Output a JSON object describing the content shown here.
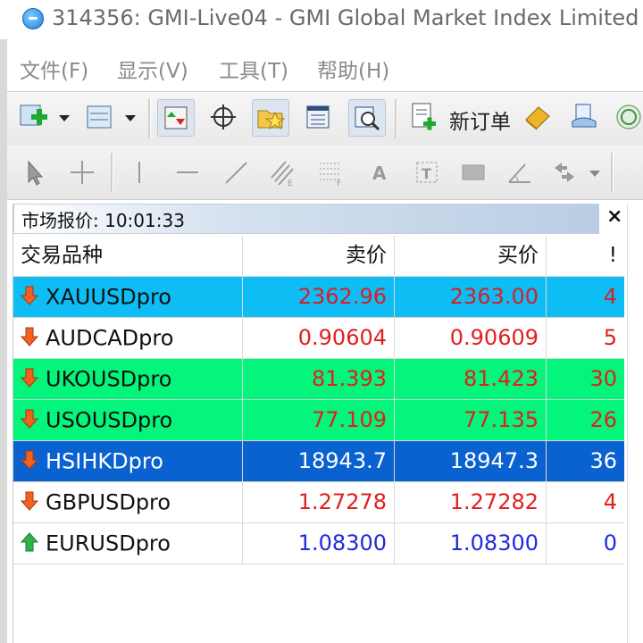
{
  "window": {
    "title": "314356: GMI-Live04 - GMI Global Market Index Limited"
  },
  "menu": [
    "文件(F)",
    "显示(V)",
    "工具(T)",
    "帮助(H)"
  ],
  "toolbar": {
    "new_order_label": "新订单"
  },
  "market_watch": {
    "title": "市场报价: 10:01:33",
    "close_label": "×",
    "columns": {
      "symbol": "交易品种",
      "bid": "卖价",
      "ask": "买价",
      "spread": "!"
    },
    "rows": [
      {
        "symbol": "XAUUSDpro",
        "bid": "2362.96",
        "ask": "2363.00",
        "spread": "4",
        "direction": "down",
        "bg": "#0dbdf4",
        "text_color": "#d81f26"
      },
      {
        "symbol": "AUDCADpro",
        "bid": "0.90604",
        "ask": "0.90609",
        "spread": "5",
        "direction": "down",
        "bg": "#ffffff",
        "text_color": "#e0201c"
      },
      {
        "symbol": "UKOUSDpro",
        "bid": "81.393",
        "ask": "81.423",
        "spread": "30",
        "direction": "down",
        "bg": "#04f57c",
        "text_color": "#e0201c"
      },
      {
        "symbol": "USOUSDpro",
        "bid": "77.109",
        "ask": "77.135",
        "spread": "26",
        "direction": "down",
        "bg": "#04f57c",
        "text_color": "#e0201c"
      },
      {
        "symbol": "HSIHKDpro",
        "bid": "18943.7",
        "ask": "18947.3",
        "spread": "36",
        "direction": "down",
        "bg": "#0a62d0",
        "text_color": "#ffffff"
      },
      {
        "symbol": "GBPUSDpro",
        "bid": "1.27278",
        "ask": "1.27282",
        "spread": "4",
        "direction": "down",
        "bg": "#ffffff",
        "text_color": "#e0201c"
      },
      {
        "symbol": "EURUSDpro",
        "bid": "1.08300",
        "ask": "1.08300",
        "spread": "0",
        "direction": "up",
        "bg": "#ffffff",
        "text_color": "#1f2adf"
      }
    ]
  }
}
